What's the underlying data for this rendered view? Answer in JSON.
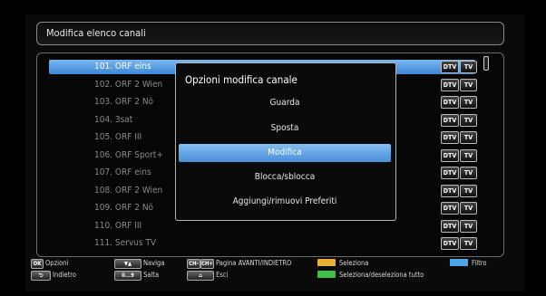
{
  "header": {
    "title": "Modifica elenco canali"
  },
  "channels": [
    {
      "label": "101. ORF eins",
      "dtv": "DTV",
      "tv": "TV"
    },
    {
      "label": "102. ORF 2 Wien",
      "dtv": "DTV",
      "tv": "TV"
    },
    {
      "label": "103. ORF 2 Nö",
      "dtv": "DTV",
      "tv": "TV"
    },
    {
      "label": "104. 3sat",
      "dtv": "DTV",
      "tv": "TV"
    },
    {
      "label": "105. ORF III",
      "dtv": "DTV",
      "tv": "TV"
    },
    {
      "label": "106. ORF Sport+",
      "dtv": "DTV",
      "tv": "TV"
    },
    {
      "label": "107. ORF eins",
      "dtv": "DTV",
      "tv": "TV"
    },
    {
      "label": "108. ORF 2 Wien",
      "dtv": "DTV",
      "tv": "TV"
    },
    {
      "label": "109. ORF 2 Nö",
      "dtv": "DTV",
      "tv": "TV"
    },
    {
      "label": "110. ORF III",
      "dtv": "DTV",
      "tv": "TV"
    },
    {
      "label": "111. Servus TV",
      "dtv": "DTV",
      "tv": "TV"
    }
  ],
  "popup": {
    "title": "Opzioni modifica canale",
    "options": [
      "Guarda",
      "Sposta",
      "Modifica",
      "Blocca/sblocca",
      "Aggiungi/rimuovi Preferiti"
    ]
  },
  "footer": {
    "ok_key": "OK",
    "ok_label": "Opzioni",
    "back_label": "Indietro",
    "nav_label": "Naviga",
    "digits_key": "0...9",
    "jump_label": "Salta",
    "ch_minus_key": "CH-",
    "ch_plus_key": "CH+",
    "page_label": "Pagina AVANTI/INDIETRO",
    "exit_label": "Esci",
    "yellow_label": "Seleziona",
    "green_label": "Seleziona/deseleziona tutto",
    "blue_label": "Filtro"
  },
  "colors": {
    "yellow": "#e8b032",
    "green": "#3fbf4a",
    "blue": "#4aa6e8",
    "highlight": "#4a8ed8"
  }
}
